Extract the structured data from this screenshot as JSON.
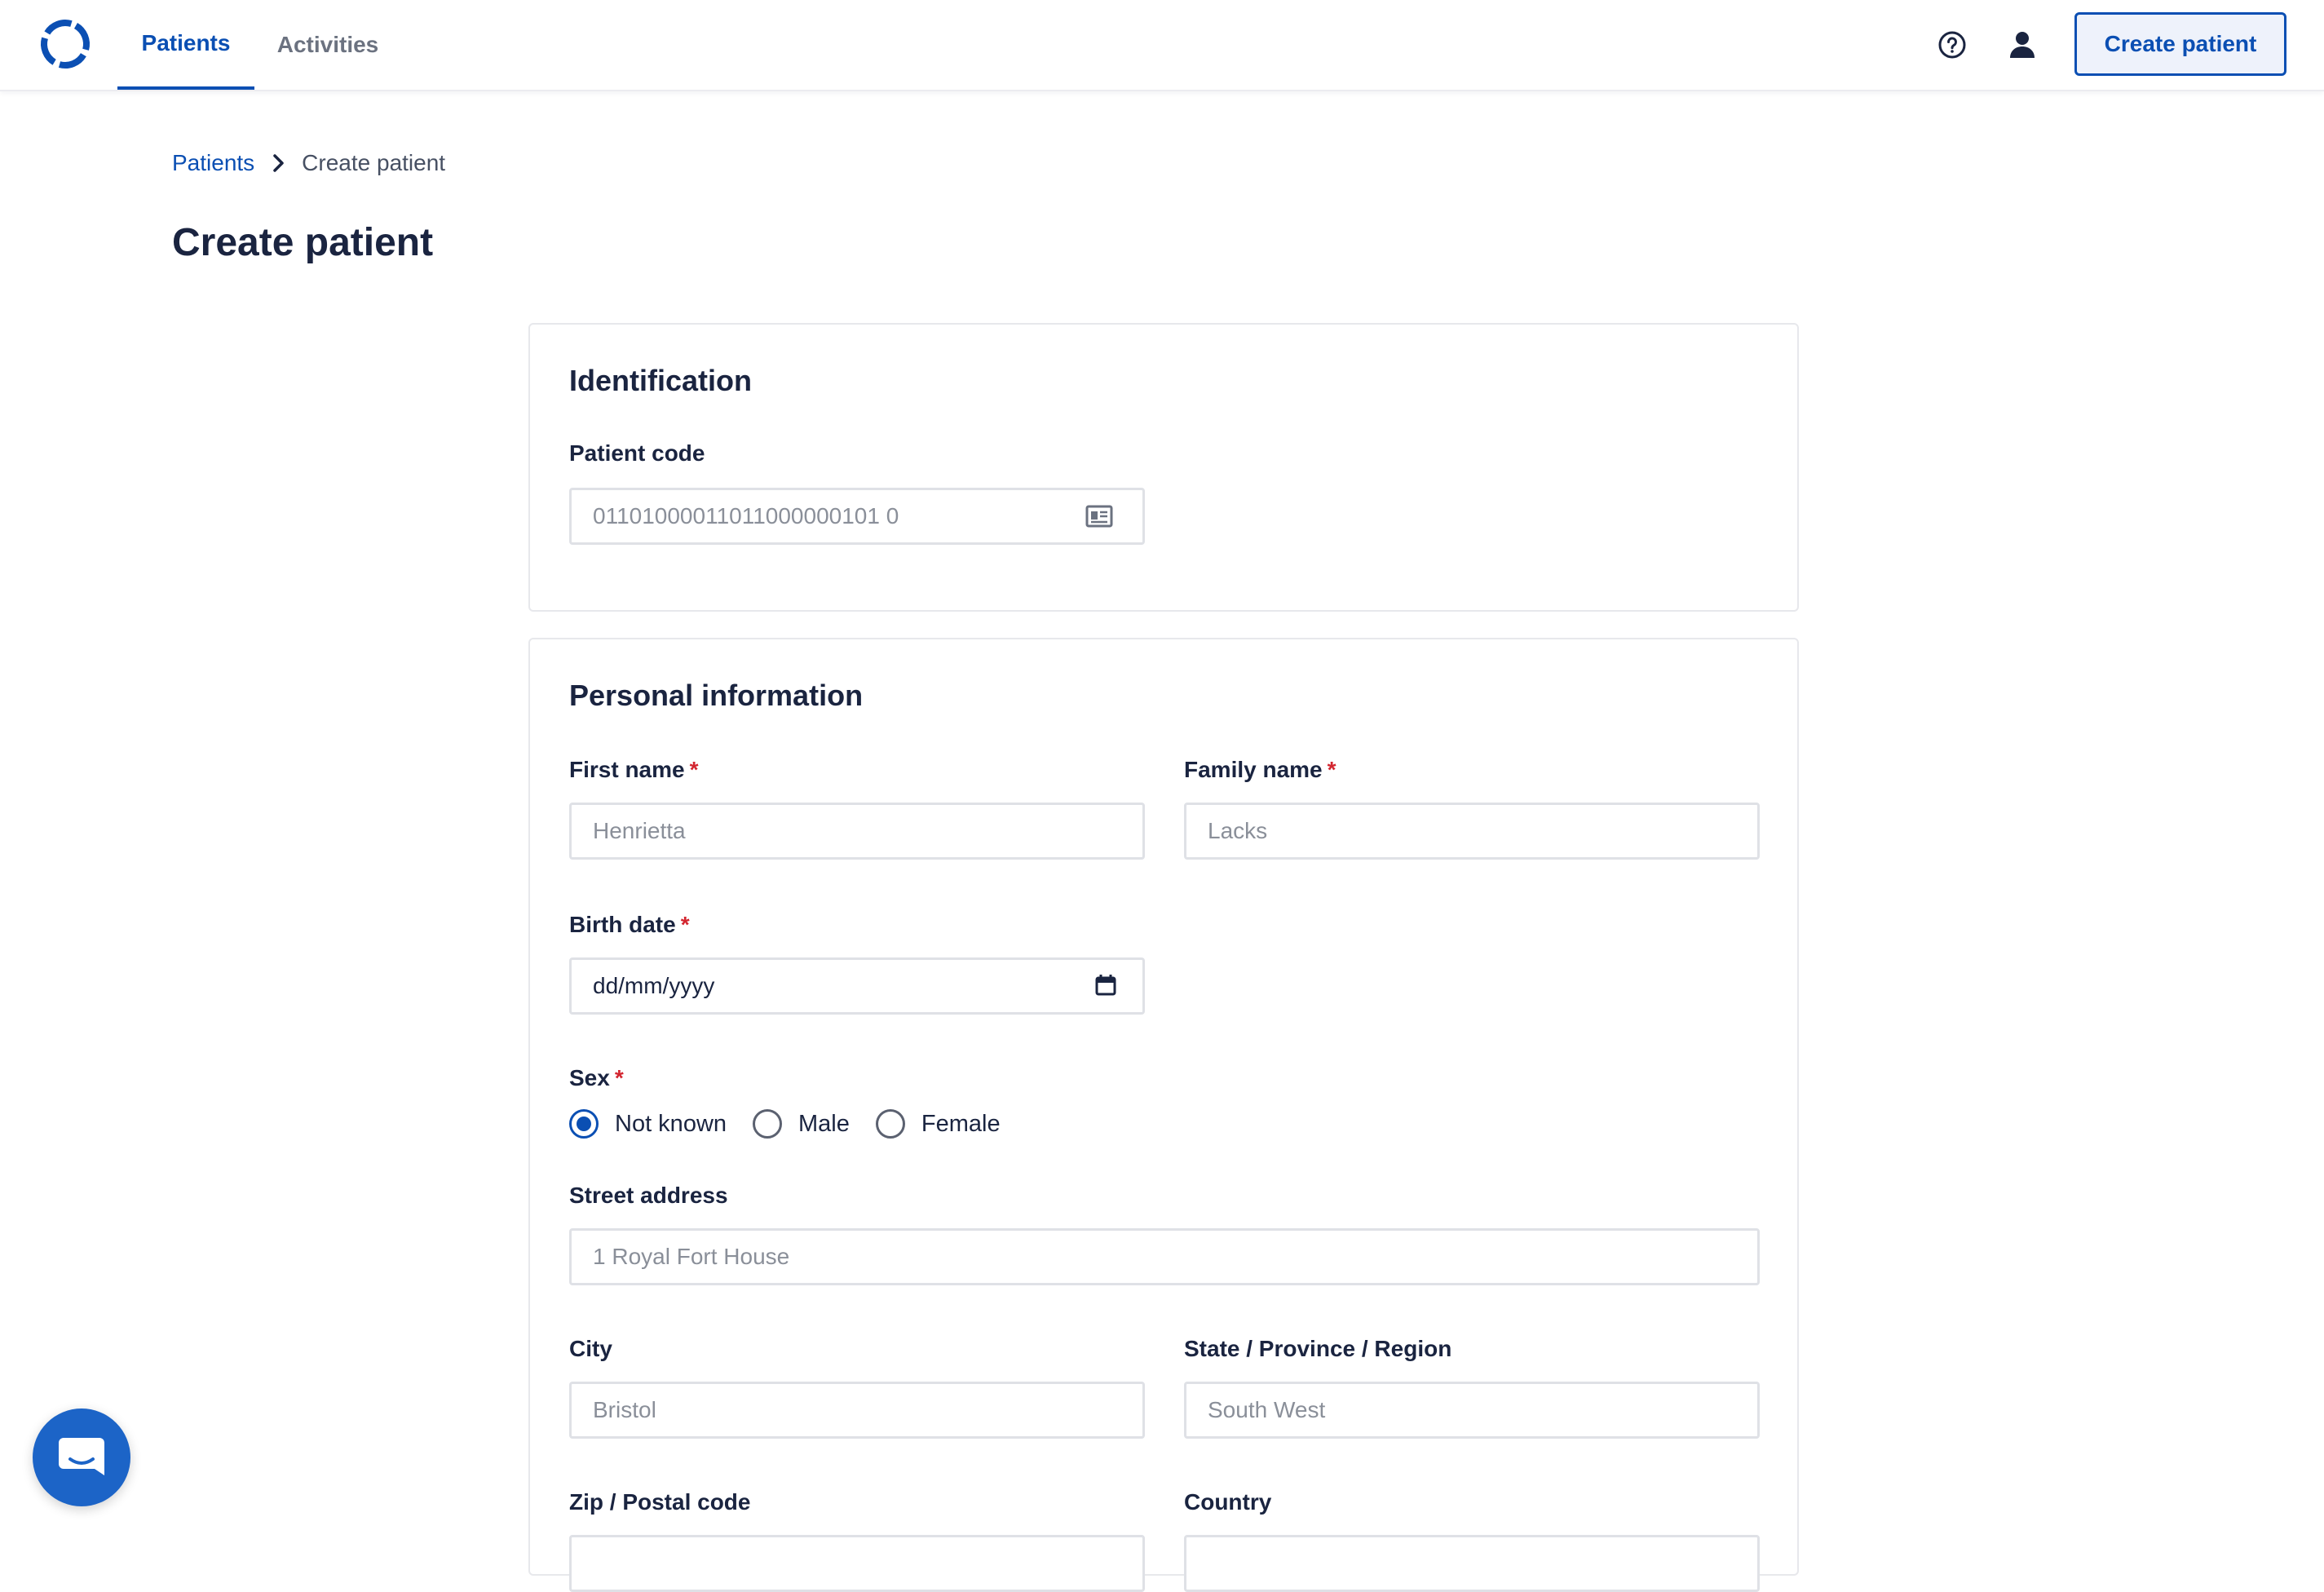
{
  "nav": {
    "tabs": [
      {
        "label": "Patients",
        "active": true
      },
      {
        "label": "Activities",
        "active": false
      }
    ],
    "create_button": "Create patient",
    "icons": {
      "logo": "app-logo",
      "help": "help-circle-icon",
      "user": "user-icon"
    }
  },
  "breadcrumb": {
    "link": "Patients",
    "separator_icon": "chevron-right-icon",
    "current": "Create patient"
  },
  "page_title": "Create patient",
  "identification": {
    "title": "Identification",
    "patient_code": {
      "label": "Patient code",
      "placeholder": "01101000011011000000101 0",
      "icon": "id-card-icon"
    }
  },
  "personal": {
    "title": "Personal information",
    "required_marker": "*",
    "first_name": {
      "label": "First name",
      "placeholder": "Henrietta"
    },
    "family_name": {
      "label": "Family name",
      "placeholder": "Lacks"
    },
    "birth_date": {
      "label": "Birth date",
      "value": "dd/mm/yyyy",
      "icon": "calendar-icon"
    },
    "sex": {
      "label": "Sex",
      "options": [
        {
          "label": "Not known",
          "checked": true
        },
        {
          "label": "Male",
          "checked": false
        },
        {
          "label": "Female",
          "checked": false
        }
      ]
    },
    "street": {
      "label": "Street address",
      "placeholder": "1 Royal Fort House"
    },
    "city": {
      "label": "City",
      "placeholder": "Bristol"
    },
    "state": {
      "label": "State / Province / Region",
      "placeholder": "South West"
    },
    "zip": {
      "label": "Zip / Postal code"
    },
    "country": {
      "label": "Country"
    }
  },
  "chat": {
    "icon": "chat-icon"
  },
  "colors": {
    "accent": "#0b4fb3",
    "required": "#d3252f",
    "text": "#1a2440",
    "chat": "#1c64c7"
  }
}
